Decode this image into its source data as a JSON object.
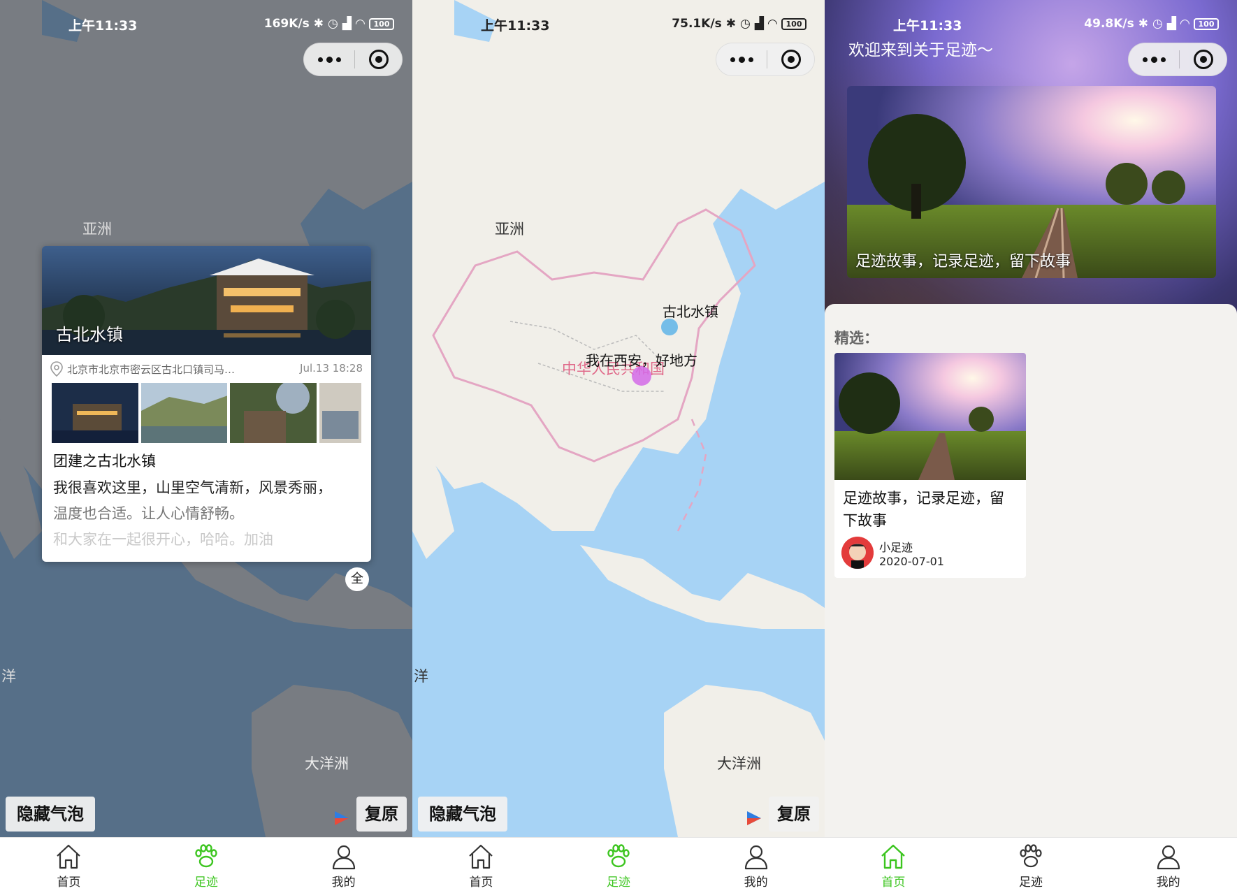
{
  "status_bars": [
    {
      "time": "上午11:33",
      "speed": "169K/s",
      "battery": "100"
    },
    {
      "time": "上午11:33",
      "speed": "75.1K/s",
      "battery": "100"
    },
    {
      "time": "上午11:33",
      "speed": "49.8K/s",
      "battery": "100"
    }
  ],
  "map": {
    "labels": {
      "asia": "亚洲",
      "ocean": "洋",
      "oceania": "大洋洲",
      "country": "中华人民共和国"
    },
    "hide_bubbles_label": "隐藏气泡",
    "restore_label": "复原",
    "markers": [
      {
        "label": "古北水镇",
        "color": "#5fb4e8"
      },
      {
        "label": "我在西安，好地方",
        "color": "#d46ae8"
      }
    ]
  },
  "popup": {
    "cover_title": "古北水镇",
    "location": "北京市北京市密云区古北口镇司马…",
    "date": "Jul.13 18:28",
    "subtitle": "团建之古北水镇",
    "lines": [
      "我很喜欢这里，山里空气清新，风景秀丽，",
      "温度也合适。让人心情舒畅。",
      "和大家在一起很开心，哈哈。加油"
    ],
    "full_label": "全"
  },
  "home": {
    "welcome": "欢迎来到关于足迹～",
    "banner_caption": "足迹故事，记录足迹，留下故事",
    "section_title": "精选：",
    "featured": {
      "title": "足迹故事，记录足迹，留下故事",
      "author": "小足迹",
      "date": "2020-07-01"
    }
  },
  "tabs": [
    {
      "label": "首页",
      "icon": "home-icon"
    },
    {
      "label": "足迹",
      "icon": "paw-icon"
    },
    {
      "label": "我的",
      "icon": "user-icon"
    }
  ],
  "colors": {
    "accent": "#3cc51f",
    "map_water": "#a7d3f5",
    "map_land": "#f1efe9",
    "border": "#e4a6c3"
  }
}
